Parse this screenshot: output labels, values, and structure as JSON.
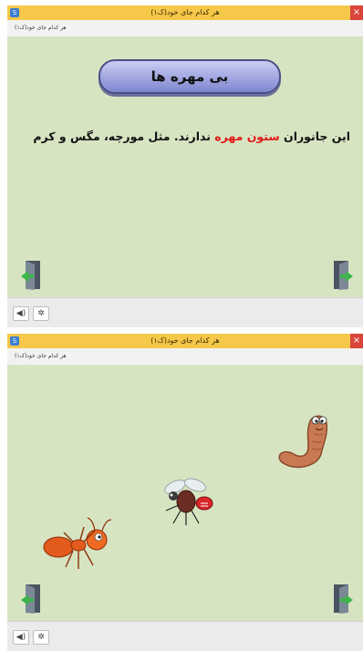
{
  "window": {
    "title": "هر کدام جای خود(ک۱)",
    "subtitle": "هر کدام جای خود(ک۱)",
    "close_glyph": "×"
  },
  "slide1": {
    "heading": "بی مهره ها",
    "text_part1": "این جانوران ",
    "text_highlight": "ستون مهره",
    "text_part2": " ندارند. مثل مورچه، مگس و کرم"
  },
  "icons": {
    "door_prev": "door-exit-icon",
    "door_next": "door-next-icon",
    "sound": "speaker-icon",
    "settings": "gear-icon",
    "worm": "worm-character",
    "fly": "fly-character",
    "ant": "ant-character"
  },
  "colors": {
    "titlebar": "#f5c84a",
    "canvas": "#d7e4c2",
    "highlight": "#e01b1b"
  }
}
